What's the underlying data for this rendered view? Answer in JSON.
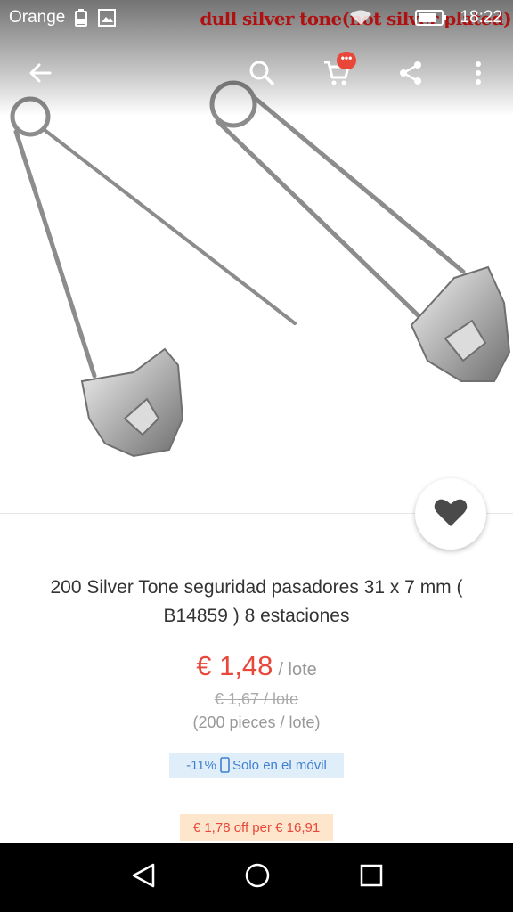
{
  "status_bar": {
    "carrier": "Orange",
    "time": "18:22",
    "icons": [
      "battery-saver-icon",
      "image-notification-icon",
      "wifi-icon",
      "battery-icon"
    ]
  },
  "watermark": "dull silver tone(not silver plated)",
  "toolbar": {
    "icons": [
      "back-arrow-icon",
      "search-icon",
      "cart-icon",
      "share-icon",
      "more-vert-icon"
    ],
    "cart_badge": "•••"
  },
  "product": {
    "title": "200 Silver Tone seguridad pasadores 31 x 7 mm ( B14859 ) 8 estaciones",
    "price": "€ 1,48",
    "price_unit": "/ lote",
    "original_price": "€ 1,67 / lote",
    "pieces": "(200 pieces / lote)",
    "mobile_discount": "-11%",
    "mobile_label": "Solo en el móvil",
    "coupon": "€ 1,78 off per € 16,91"
  },
  "colors": {
    "accent": "#e8473a",
    "mobile_tag_bg": "#e0eefa",
    "mobile_tag_text": "#3f7fcf",
    "coupon_bg": "#fde6cc",
    "watermark": "#b01010"
  },
  "nav_bar": {
    "icons": [
      "back-triangle-icon",
      "home-circle-icon",
      "recents-square-icon"
    ]
  }
}
